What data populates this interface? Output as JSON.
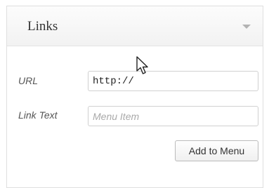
{
  "panel": {
    "title": "Links",
    "toggle_icon": "chevron-down-icon"
  },
  "form": {
    "url_label": "URL",
    "url_value": "http://",
    "link_text_label": "Link Text",
    "link_text_placeholder": "Menu Item",
    "add_button_label": "Add to Menu"
  },
  "cursor": {
    "icon": "mouse-pointer-icon"
  }
}
